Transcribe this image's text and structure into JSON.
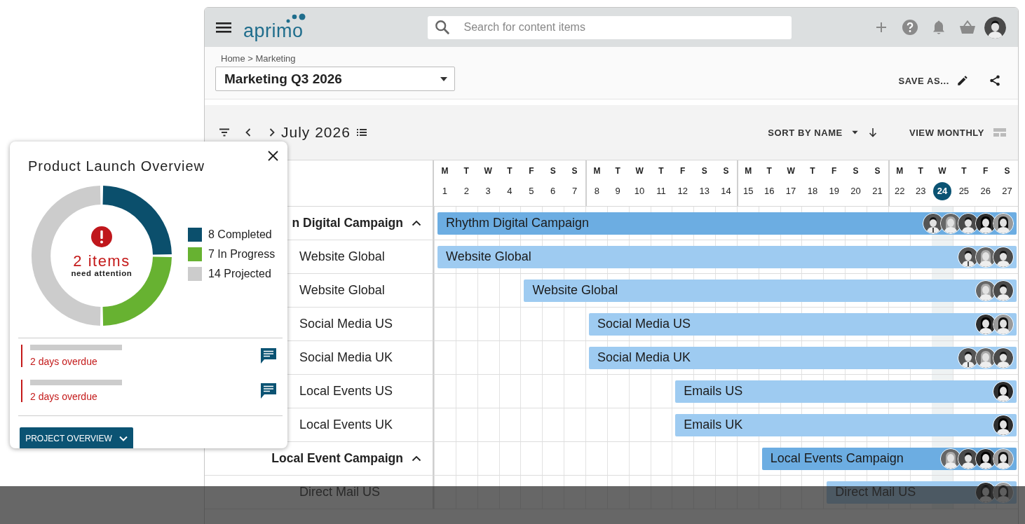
{
  "topbar": {
    "logo": "aprimo",
    "search": {
      "placeholder": "Search for content items"
    }
  },
  "header": {
    "breadcrumb": "Home > Marketing",
    "plan_select": "Marketing Q3 2026",
    "save_as": "SAVE AS..."
  },
  "toolbar": {
    "month": "July 2026",
    "sort": "SORT BY NAME",
    "view": "VIEW MONTHLY"
  },
  "days": [
    {
      "letter": "M",
      "number": "1",
      "today": false
    },
    {
      "letter": "T",
      "number": "2",
      "today": false
    },
    {
      "letter": "W",
      "number": "3",
      "today": false
    },
    {
      "letter": "T",
      "number": "4",
      "today": false
    },
    {
      "letter": "F",
      "number": "5",
      "today": false
    },
    {
      "letter": "S",
      "number": "6",
      "today": false
    },
    {
      "letter": "S",
      "number": "7",
      "today": false
    },
    {
      "letter": "M",
      "number": "8",
      "today": false
    },
    {
      "letter": "T",
      "number": "9",
      "today": false
    },
    {
      "letter": "W",
      "number": "10",
      "today": false
    },
    {
      "letter": "T",
      "number": "11",
      "today": false
    },
    {
      "letter": "F",
      "number": "12",
      "today": false
    },
    {
      "letter": "S",
      "number": "13",
      "today": false
    },
    {
      "letter": "S",
      "number": "14",
      "today": false
    },
    {
      "letter": "M",
      "number": "15",
      "today": false
    },
    {
      "letter": "T",
      "number": "16",
      "today": false
    },
    {
      "letter": "W",
      "number": "17",
      "today": false
    },
    {
      "letter": "T",
      "number": "18",
      "today": false
    },
    {
      "letter": "F",
      "number": "19",
      "today": false
    },
    {
      "letter": "S",
      "number": "20",
      "today": false
    },
    {
      "letter": "S",
      "number": "21",
      "today": false
    },
    {
      "letter": "M",
      "number": "22",
      "today": false
    },
    {
      "letter": "T",
      "number": "23",
      "today": false
    },
    {
      "letter": "W",
      "number": "24",
      "today": true
    },
    {
      "letter": "T",
      "number": "25",
      "today": false
    },
    {
      "letter": "F",
      "number": "26",
      "today": false
    },
    {
      "letter": "S",
      "number": "27",
      "today": false
    }
  ],
  "rows": [
    {
      "kind": "group",
      "label": "n Digital Campaign",
      "expanded": true,
      "bar": {
        "label": "Rhythm Digital Campaign",
        "avatars": [
          {
            "kind": "man-tie"
          },
          {
            "kind": "woman-gray"
          },
          {
            "kind": "man"
          },
          {
            "kind": "woman-dark"
          },
          {
            "kind": "woman-light"
          }
        ]
      }
    },
    {
      "kind": "item",
      "label": "Website Global",
      "bar": {
        "label": "Website Global",
        "avatars": [
          {
            "kind": "man-tie"
          },
          {
            "kind": "woman-gray"
          },
          {
            "kind": "man"
          }
        ]
      }
    },
    {
      "kind": "item",
      "label": "Website Global",
      "bar": {
        "label": "Website Global",
        "avatars": [
          {
            "kind": "woman-gray"
          },
          {
            "kind": "man"
          }
        ]
      }
    },
    {
      "kind": "item",
      "label": "Social Media US",
      "bar": {
        "label": "Social Media US",
        "avatars": [
          {
            "kind": "woman-dark"
          },
          {
            "kind": "woman-light"
          }
        ]
      }
    },
    {
      "kind": "item",
      "label": "Social Media UK",
      "bar": {
        "label": "Social Media UK",
        "avatars": [
          {
            "kind": "man-tie"
          },
          {
            "kind": "woman-gray"
          },
          {
            "kind": "man"
          }
        ]
      }
    },
    {
      "kind": "item",
      "label": "Local Events US",
      "bar": {
        "label": "Emails US",
        "avatars": [
          {
            "kind": "woman-dark"
          }
        ]
      }
    },
    {
      "kind": "item",
      "label": "Local Events UK",
      "bar": {
        "label": "Emails UK",
        "avatars": [
          {
            "kind": "woman-dark"
          }
        ]
      }
    },
    {
      "kind": "group",
      "label": "Local Event Campaign",
      "expanded": true,
      "bar": {
        "label": "Local Events Campaign",
        "avatars": [
          {
            "kind": "woman-gray"
          },
          {
            "kind": "man"
          },
          {
            "kind": "woman-dark"
          },
          {
            "kind": "woman-light"
          }
        ]
      }
    },
    {
      "kind": "item",
      "label": "Direct Mail US",
      "bar": {
        "label": "Direct Mail US",
        "avatars": [
          {
            "kind": "woman-dark"
          },
          {
            "kind": "woman-light"
          }
        ]
      }
    }
  ],
  "popup": {
    "title": "Product Launch Overview",
    "center_value": "2 items",
    "center_caption": "need attention",
    "chart_data": {
      "type": "donut",
      "values": [
        25,
        25,
        50
      ]
    },
    "legend": [
      {
        "label": "8 Completed",
        "color": "#0b4f6c"
      },
      {
        "label": "7 In Progress",
        "color": "#67b231"
      },
      {
        "label": "14 Projected",
        "color": "#cccccc"
      }
    ],
    "alerts": [
      {
        "text": "2 days overdue"
      },
      {
        "text": "2 days overdue"
      }
    ],
    "button": "PROJECT OVERVIEW"
  }
}
